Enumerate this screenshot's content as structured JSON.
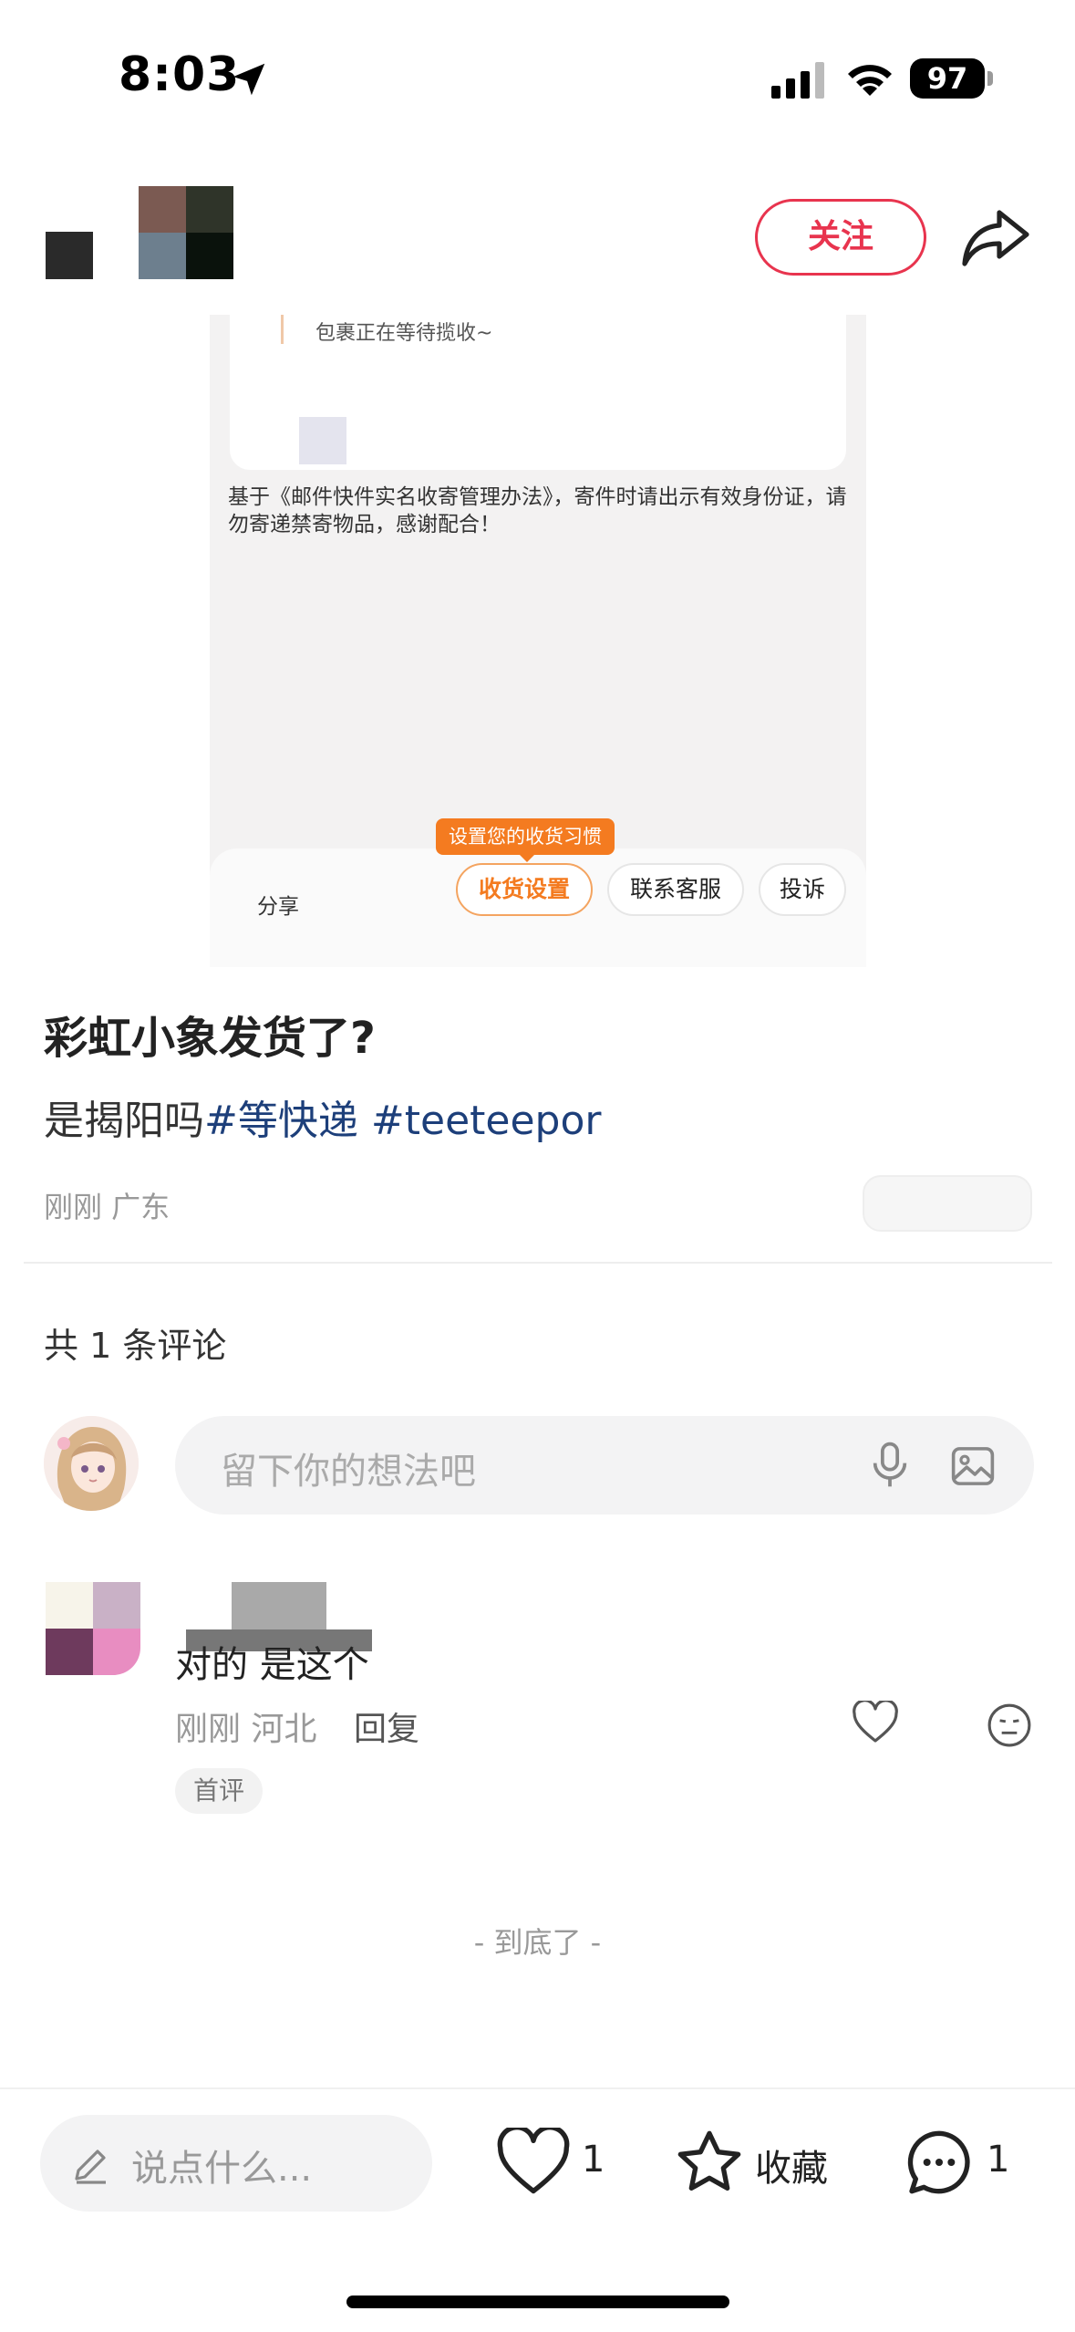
{
  "status_bar": {
    "time": "8:03",
    "battery": "97"
  },
  "header": {
    "follow_label": "关注"
  },
  "post_image": {
    "status_text": "包裹正在等待揽收~",
    "notice": "基于《邮件快件实名收寄管理办法》，寄件时请出示有效身份证，请勿寄递禁寄物品，感谢配合！",
    "tooltip": "设置您的收货习惯",
    "share_label": "分享",
    "buttons": [
      "收货设置",
      "联系客服",
      "投诉"
    ]
  },
  "post": {
    "title": "彩虹小象发货了?",
    "desc_text": "是揭阳吗",
    "tags": [
      "#等快递",
      "#teeteepor"
    ],
    "meta": "刚刚 广东"
  },
  "comments": {
    "count_label": "共 1 条评论",
    "input_placeholder": "留下你的想法吧",
    "items": [
      {
        "text": "对的 是这个",
        "meta": "刚刚 河北",
        "reply_label": "回复",
        "badge": "首评"
      }
    ],
    "end_text": "- 到底了 -"
  },
  "bottom_bar": {
    "say_placeholder": "说点什么...",
    "like_count": "1",
    "collect_label": "收藏",
    "comment_count": "1"
  },
  "colors": {
    "accent": "#e8344e",
    "tag": "#1d3f7a",
    "orange": "#f47b20"
  }
}
